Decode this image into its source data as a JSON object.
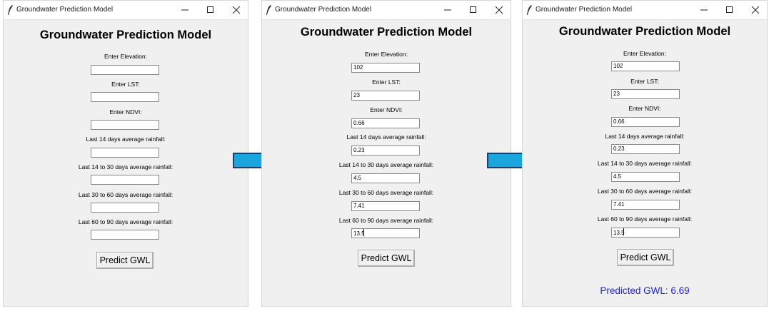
{
  "app": {
    "window_title": "Groundwater Prediction Model",
    "heading": "Groundwater Prediction Model",
    "predict_button": "Predict GWL"
  },
  "window_controls": {
    "minimize_icon": "minimize-icon",
    "maximize_icon": "maximize-icon",
    "close_icon": "close-icon"
  },
  "fields": [
    {
      "label": "Enter Elevation:"
    },
    {
      "label": "Enter LST:"
    },
    {
      "label": "Enter NDVI:"
    },
    {
      "label": "Last 14 days average rainfall:"
    },
    {
      "label": "Last 14 to 30 days average rainfall:"
    },
    {
      "label": "Last 30 to 60 days average rainfall:"
    },
    {
      "label": "Last 60 to 90 days average rainfall:"
    }
  ],
  "windows": [
    {
      "values": [
        "",
        "",
        "",
        "",
        "",
        "",
        ""
      ],
      "result": ""
    },
    {
      "values": [
        "102",
        "23",
        "0.66",
        "0.23",
        "4.5",
        "7.41",
        "13.5"
      ],
      "result": ""
    },
    {
      "values": [
        "102",
        "23",
        "0.66",
        "0.23",
        "4.5",
        "7.41",
        "13.5"
      ],
      "result": "Predicted GWL: 6.69"
    }
  ],
  "colors": {
    "window_bg": "#f0f0f0",
    "result_text": "#1f1fe8",
    "arrow_fill": "#1aa6dc",
    "arrow_stroke": "#1f3e6b"
  },
  "icons": {
    "app_icon": "feather-icon",
    "flow_arrow": "right-arrow-icon"
  }
}
